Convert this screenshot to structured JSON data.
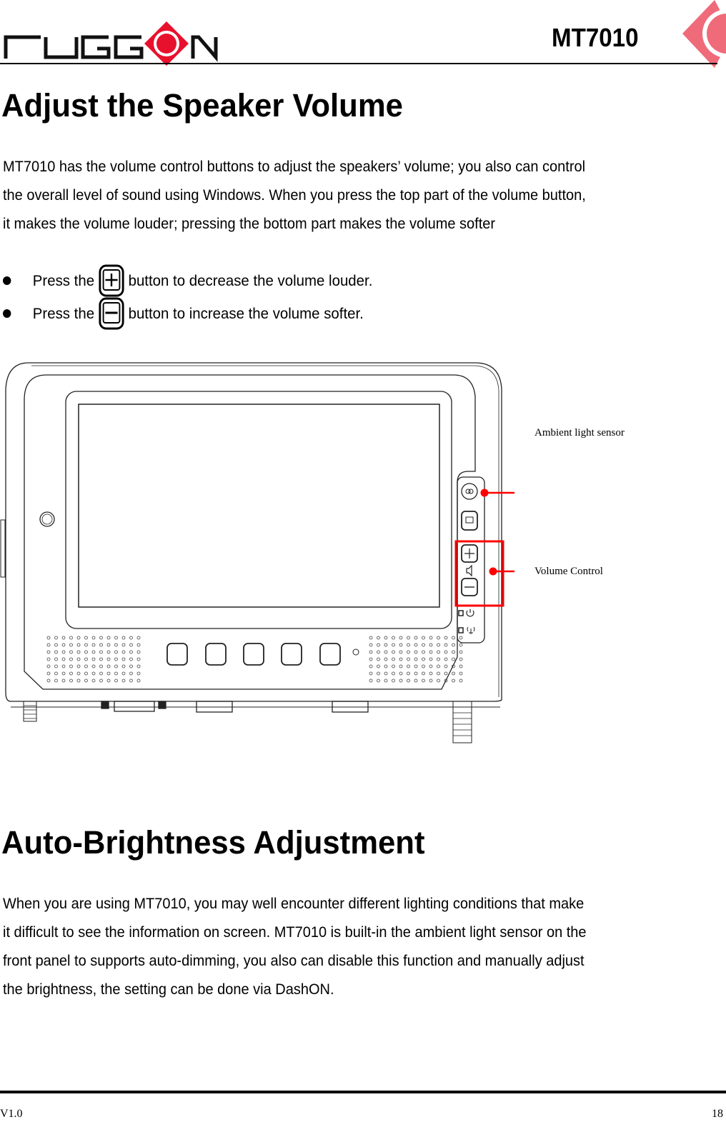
{
  "header": {
    "brand": "ruggon",
    "model": "MT7010",
    "brand_color": "#e8112d"
  },
  "sections": [
    {
      "title": "Adjust the Speaker Volume",
      "paragraph_lines": [
        "MT7010 has the volume control buttons to adjust the speakers’ volume; you also can control",
        "the overall level of sound using Windows. When you press the top part of the volume button,",
        "it makes the volume louder; pressing the bottom part makes the volume softer"
      ],
      "bullets": [
        {
          "prefix": "Press the",
          "icon": "plus-button-icon",
          "suffix": "button to decrease the volume louder."
        },
        {
          "prefix": "Press the",
          "icon": "minus-button-icon",
          "suffix": "button to increase the volume softer."
        }
      ]
    },
    {
      "title": "Auto-Brightness Adjustment",
      "paragraph_lines": [
        "When you are using MT7010, you may well encounter different lighting conditions that make",
        "it difficult to see the information on screen. MT7010 is built-in the ambient light sensor on the",
        "front panel to supports auto-dimming, you also can disable this function and manually adjust",
        "the brightness, the setting can be done via DashON."
      ]
    }
  ],
  "figure": {
    "callouts": [
      {
        "label": "Ambient light sensor",
        "target": "ambient-light-sensor"
      },
      {
        "label": "Volume Control",
        "target": "volume-buttons"
      }
    ],
    "callout_color": "#ff0000"
  },
  "footer": {
    "version": "V1.0",
    "page_number": "18"
  }
}
